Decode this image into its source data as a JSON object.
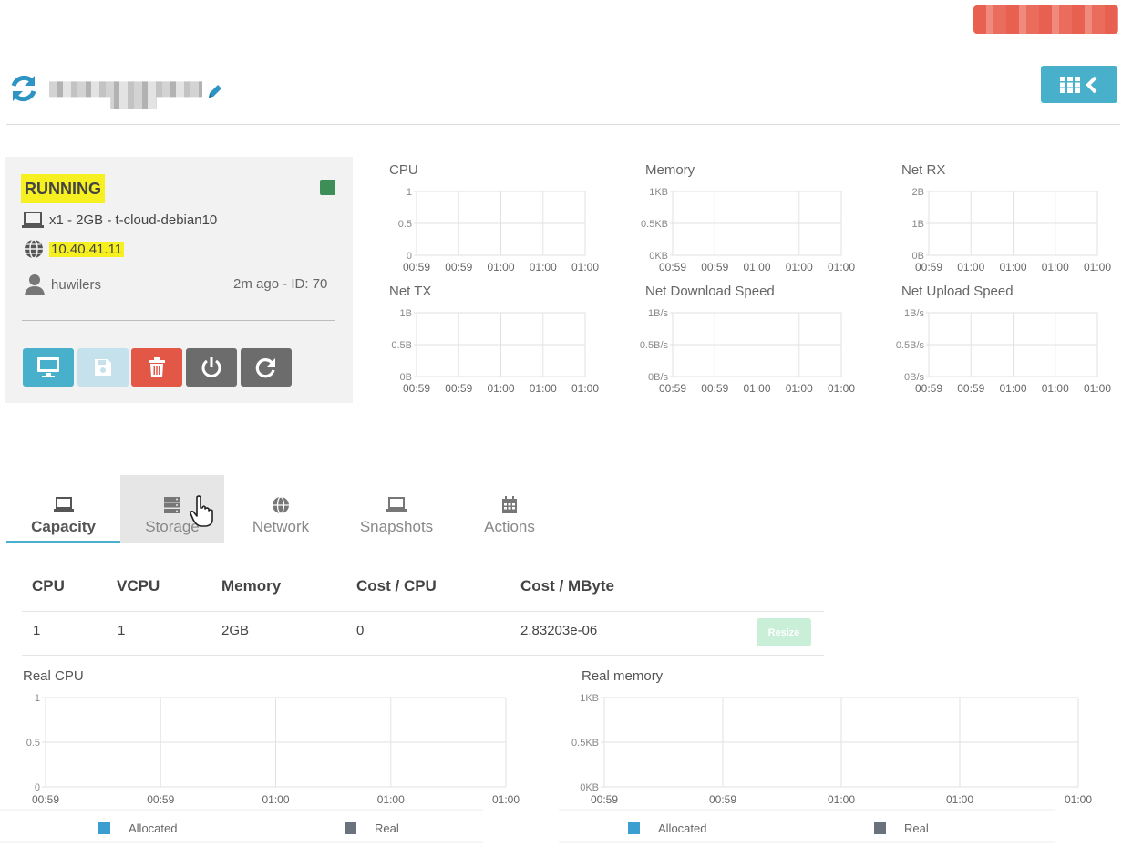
{
  "header": {
    "edit_icon": "pencil-icon",
    "refresh_icon": "refresh-icon",
    "toggle_icons": [
      "grid-icon",
      "chevron-left-icon"
    ]
  },
  "vm": {
    "status": "RUNNING",
    "status_color": "#3e8e58",
    "spec": "x1 - 2GB - t-cloud-debian10",
    "ip": "10.40.41.11",
    "owner": "huwilers",
    "created": "2m ago - ID: 70"
  },
  "actions": [
    "VNC",
    "Save",
    "Delete",
    "Power off",
    "Reboot"
  ],
  "mini_charts": [
    {
      "title": "CPU",
      "yticks": [
        "1",
        "0.5",
        "0"
      ],
      "xticks": [
        "00:59",
        "00:59",
        "01:00",
        "01:00",
        "01:00"
      ]
    },
    {
      "title": "Memory",
      "yticks": [
        "1KB",
        "0.5KB",
        "0KB"
      ],
      "xticks": [
        "00:59",
        "00:59",
        "01:00",
        "01:00",
        "01:00"
      ]
    },
    {
      "title": "Net RX",
      "yticks": [
        "2B",
        "1B",
        "0B"
      ],
      "xticks": [
        "00:59",
        "01:00",
        "01:00",
        "01:00",
        "01:00"
      ]
    },
    {
      "title": "Net TX",
      "yticks": [
        "1B",
        "0.5B",
        "0B"
      ],
      "xticks": [
        "00:59",
        "00:59",
        "01:00",
        "01:00",
        "01:00"
      ]
    },
    {
      "title": "Net Download Speed",
      "yticks": [
        "1B/s",
        "0.5B/s",
        "0B/s"
      ],
      "xticks": [
        "00:59",
        "00:59",
        "01:00",
        "01:00",
        "01:00"
      ]
    },
    {
      "title": "Net Upload Speed",
      "yticks": [
        "1B/s",
        "0.5B/s",
        "0B/s"
      ],
      "xticks": [
        "00:59",
        "00:59",
        "01:00",
        "01:00",
        "01:00"
      ]
    }
  ],
  "tabs": [
    {
      "label": "Capacity",
      "icon": "laptop-icon"
    },
    {
      "label": "Storage",
      "icon": "server-icon"
    },
    {
      "label": "Network",
      "icon": "globe-icon"
    },
    {
      "label": "Snapshots",
      "icon": "laptop-icon"
    },
    {
      "label": "Actions",
      "icon": "calendar-icon"
    }
  ],
  "capacity": {
    "headers": [
      "CPU",
      "VCPU",
      "Memory",
      "Cost / CPU",
      "Cost / MByte"
    ],
    "row": [
      "1",
      "1",
      "2GB",
      "0",
      "2.83203e-06"
    ],
    "resize_label": "Resize"
  },
  "real_charts": [
    {
      "title": "Real CPU",
      "yticks": [
        "1",
        "0.5",
        "0"
      ],
      "xticks": [
        "00:59",
        "00:59",
        "01:00",
        "01:00",
        "01:00"
      ]
    },
    {
      "title": "Real memory",
      "yticks": [
        "1KB",
        "0.5KB",
        "0KB"
      ],
      "xticks": [
        "00:59",
        "00:59",
        "01:00",
        "01:00",
        "01:00"
      ]
    }
  ],
  "legend": [
    {
      "label": "Allocated",
      "color": "#3a9fd0"
    },
    {
      "label": "Real",
      "color": "#6a737d"
    }
  ],
  "colors": {
    "accent": "#48b0cb",
    "danger": "#e35746",
    "highlight": "#f6f020"
  }
}
